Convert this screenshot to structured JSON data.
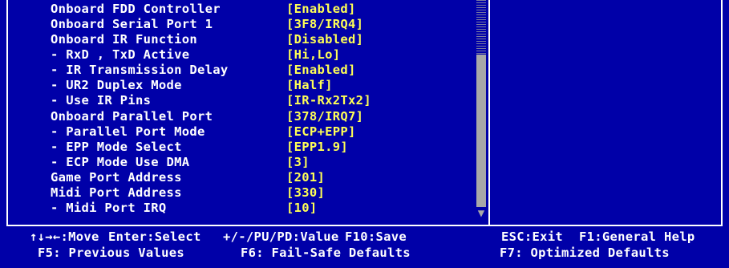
{
  "settings": [
    {
      "label": "Onboard FDD Controller",
      "value": "[Enabled]",
      "indent": false
    },
    {
      "label": "Onboard Serial Port 1",
      "value": "[3F8/IRQ4]",
      "indent": false
    },
    {
      "label": "Onboard IR Function",
      "value": "[Disabled]",
      "indent": false
    },
    {
      "label": "- RxD , TxD Active",
      "value": "[Hi,Lo]",
      "indent": true
    },
    {
      "label": "- IR Transmission Delay",
      "value": "[Enabled]",
      "indent": true
    },
    {
      "label": "- UR2 Duplex Mode",
      "value": "[Half]",
      "indent": true
    },
    {
      "label": "- Use IR Pins",
      "value": "[IR-Rx2Tx2]",
      "indent": true
    },
    {
      "label": "Onboard Parallel Port",
      "value": "[378/IRQ7]",
      "indent": false
    },
    {
      "label": "- Parallel Port Mode",
      "value": "[ECP+EPP]",
      "indent": true
    },
    {
      "label": "- EPP Mode Select",
      "value": "[EPP1.9]",
      "indent": true
    },
    {
      "label": "- ECP Mode Use DMA",
      "value": "[3]",
      "indent": true
    },
    {
      "label": "Game Port Address",
      "value": "[201]",
      "indent": false
    },
    {
      "label": "Midi Port Address",
      "value": "[330]",
      "indent": false
    },
    {
      "label": "- Midi Port IRQ",
      "value": "[10]",
      "indent": true
    }
  ],
  "legend": {
    "move": "↑↓→←:Move",
    "enter": "Enter:Select",
    "value": "+/-/PU/PD:Value",
    "save": "F10:Save",
    "exit": "ESC:Exit",
    "help": "F1:General Help",
    "previous": "F5: Previous Values",
    "failsafe": "F6: Fail-Safe Defaults",
    "optimized": "F7: Optimized Defaults"
  },
  "scrollbar": {
    "down_arrow_icon": "down-arrow"
  },
  "colors": {
    "background": "#0000a8",
    "label": "#ffffff",
    "value": "#ffff55",
    "scroll_thumb": "#a8a8a8"
  }
}
